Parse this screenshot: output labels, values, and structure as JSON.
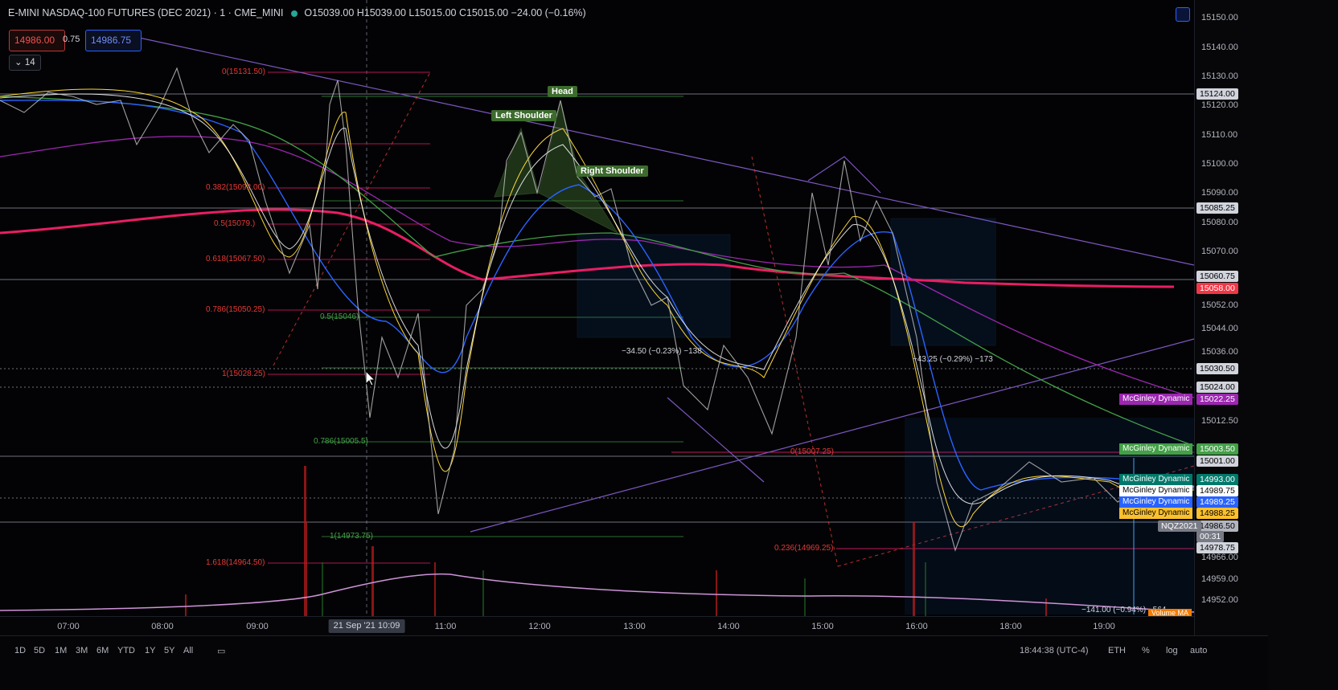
{
  "legend": {
    "symbol": "E-MINI NASDAQ-100 FUTURES (DEC 2021) · 1 · CME_MINI",
    "ohlc": "O15039.00 H15039.00 L15015.00 C15015.00 −24.00 (−0.16%)"
  },
  "order": {
    "sell": "14986.00",
    "spread": "0.75",
    "buy": "14986.75"
  },
  "indicator_toggle": "14",
  "price_axis": {
    "ticks": [
      "15150.00",
      "15140.00",
      "15130.00",
      "15120.00",
      "15110.00",
      "15100.00",
      "15090.00",
      "15080.00",
      "15070.00",
      "15052.00",
      "15044.00",
      "15036.00",
      "15012.50",
      "14966.00",
      "14959.00",
      "14952.00"
    ],
    "labels": [
      {
        "text": "15124.00",
        "bg": "#d1d4dc",
        "fg": "#000000"
      },
      {
        "text": "15085.25",
        "bg": "#d1d4dc",
        "fg": "#000000"
      },
      {
        "text": "15060.75",
        "bg": "#d1d4dc",
        "fg": "#000000"
      },
      {
        "text": "15058.00",
        "bg": "#f23645",
        "fg": "#ffffff"
      },
      {
        "text": "15030.50",
        "bg": "#d1d4dc",
        "fg": "#000000"
      },
      {
        "text": "15024.00",
        "bg": "#d1d4dc",
        "fg": "#000000"
      },
      {
        "text": "15022.25",
        "bg": "#9c27b0",
        "fg": "#ffffff"
      },
      {
        "text": "15003.50",
        "bg": "#43a047",
        "fg": "#ffffff"
      },
      {
        "text": "15001.00",
        "bg": "#d1d4dc",
        "fg": "#000000"
      },
      {
        "text": "14993.00",
        "bg": "#00796b",
        "fg": "#ffffff"
      },
      {
        "text": "14989.75",
        "bg": "#ffffff",
        "fg": "#000000"
      },
      {
        "text": "14989.25",
        "bg": "#2962ff",
        "fg": "#ffffff"
      },
      {
        "text": "14988.25",
        "bg": "#fbc02d",
        "fg": "#000000"
      },
      {
        "text": "14986.50",
        "bg": "#b2b5be",
        "fg": "#000000"
      },
      {
        "text": "NQZ2021",
        "bg": "#787b86",
        "fg": "#ffffff"
      },
      {
        "text": "00:31",
        "bg": "#787b86",
        "fg": "#ffffff"
      },
      {
        "text": "14978.75",
        "bg": "#d1d4dc",
        "fg": "#000000"
      }
    ]
  },
  "mcginley": [
    {
      "text": "McGinley Dynamic",
      "bg": "#9c27b0"
    },
    {
      "text": "McGinley Dynamic",
      "bg": "#43a047"
    },
    {
      "text": "McGinley Dynamic",
      "bg": "#00796b"
    },
    {
      "text": "McGinley Dynamic",
      "bg": "#ffffff"
    },
    {
      "text": "McGinley Dynamic",
      "bg": "#2962ff"
    },
    {
      "text": "McGinley Dynamic",
      "bg": "#fbc02d"
    }
  ],
  "volume_label": "Volume MA",
  "time_axis": [
    "07:00",
    "08:00",
    "09:00",
    "11:00",
    "12:00",
    "13:00",
    "14:00",
    "15:00",
    "16:00",
    "18:00",
    "19:00"
  ],
  "crosshair_date": "21 Sep '21  10:09",
  "annotations": {
    "head": "Head",
    "left_shoulder": "Left Shoulder",
    "right_shoulder": "Right Shoulder"
  },
  "fib_left": [
    "0(15131.50)",
    "0.382(15092.00)",
    "0.5(15079.)",
    "0.618(15067.50)",
    "0.786(15050.25)",
    "1(15028.25)",
    "1.618(14964.50)"
  ],
  "fib_mid": [
    "0.786(15005.5)",
    "1(14973.75)",
    "0.5(15046)"
  ],
  "fib_right": [
    "0(15007.25)",
    "0.236(14969.25)"
  ],
  "measure_1": "−34.50 (−0.23%) −138",
  "measure_2": "−43.25 (−0.29%) −173",
  "measure_3": "−141.00 (−0.94%) −564",
  "bottom_periods": [
    "1D",
    "5D",
    "1M",
    "3M",
    "6M",
    "YTD",
    "1Y",
    "5Y",
    "All"
  ],
  "bottom_right": [
    "18:44:38 (UTC-4)",
    "ETH",
    "%",
    "log",
    "auto"
  ]
}
